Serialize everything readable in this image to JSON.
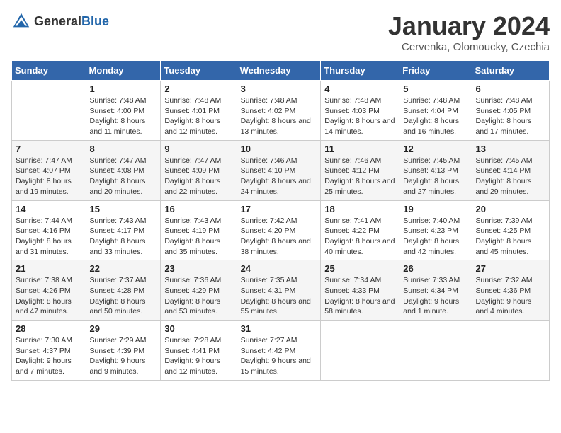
{
  "logo": {
    "general": "General",
    "blue": "Blue"
  },
  "header": {
    "month": "January 2024",
    "location": "Cervenka, Olomoucky, Czechia"
  },
  "weekdays": [
    "Sunday",
    "Monday",
    "Tuesday",
    "Wednesday",
    "Thursday",
    "Friday",
    "Saturday"
  ],
  "weeks": [
    [
      {
        "day": "",
        "sunrise": "",
        "sunset": "",
        "daylight": ""
      },
      {
        "day": "1",
        "sunrise": "Sunrise: 7:48 AM",
        "sunset": "Sunset: 4:00 PM",
        "daylight": "Daylight: 8 hours and 11 minutes."
      },
      {
        "day": "2",
        "sunrise": "Sunrise: 7:48 AM",
        "sunset": "Sunset: 4:01 PM",
        "daylight": "Daylight: 8 hours and 12 minutes."
      },
      {
        "day": "3",
        "sunrise": "Sunrise: 7:48 AM",
        "sunset": "Sunset: 4:02 PM",
        "daylight": "Daylight: 8 hours and 13 minutes."
      },
      {
        "day": "4",
        "sunrise": "Sunrise: 7:48 AM",
        "sunset": "Sunset: 4:03 PM",
        "daylight": "Daylight: 8 hours and 14 minutes."
      },
      {
        "day": "5",
        "sunrise": "Sunrise: 7:48 AM",
        "sunset": "Sunset: 4:04 PM",
        "daylight": "Daylight: 8 hours and 16 minutes."
      },
      {
        "day": "6",
        "sunrise": "Sunrise: 7:48 AM",
        "sunset": "Sunset: 4:05 PM",
        "daylight": "Daylight: 8 hours and 17 minutes."
      }
    ],
    [
      {
        "day": "7",
        "sunrise": "Sunrise: 7:47 AM",
        "sunset": "Sunset: 4:07 PM",
        "daylight": "Daylight: 8 hours and 19 minutes."
      },
      {
        "day": "8",
        "sunrise": "Sunrise: 7:47 AM",
        "sunset": "Sunset: 4:08 PM",
        "daylight": "Daylight: 8 hours and 20 minutes."
      },
      {
        "day": "9",
        "sunrise": "Sunrise: 7:47 AM",
        "sunset": "Sunset: 4:09 PM",
        "daylight": "Daylight: 8 hours and 22 minutes."
      },
      {
        "day": "10",
        "sunrise": "Sunrise: 7:46 AM",
        "sunset": "Sunset: 4:10 PM",
        "daylight": "Daylight: 8 hours and 24 minutes."
      },
      {
        "day": "11",
        "sunrise": "Sunrise: 7:46 AM",
        "sunset": "Sunset: 4:12 PM",
        "daylight": "Daylight: 8 hours and 25 minutes."
      },
      {
        "day": "12",
        "sunrise": "Sunrise: 7:45 AM",
        "sunset": "Sunset: 4:13 PM",
        "daylight": "Daylight: 8 hours and 27 minutes."
      },
      {
        "day": "13",
        "sunrise": "Sunrise: 7:45 AM",
        "sunset": "Sunset: 4:14 PM",
        "daylight": "Daylight: 8 hours and 29 minutes."
      }
    ],
    [
      {
        "day": "14",
        "sunrise": "Sunrise: 7:44 AM",
        "sunset": "Sunset: 4:16 PM",
        "daylight": "Daylight: 8 hours and 31 minutes."
      },
      {
        "day": "15",
        "sunrise": "Sunrise: 7:43 AM",
        "sunset": "Sunset: 4:17 PM",
        "daylight": "Daylight: 8 hours and 33 minutes."
      },
      {
        "day": "16",
        "sunrise": "Sunrise: 7:43 AM",
        "sunset": "Sunset: 4:19 PM",
        "daylight": "Daylight: 8 hours and 35 minutes."
      },
      {
        "day": "17",
        "sunrise": "Sunrise: 7:42 AM",
        "sunset": "Sunset: 4:20 PM",
        "daylight": "Daylight: 8 hours and 38 minutes."
      },
      {
        "day": "18",
        "sunrise": "Sunrise: 7:41 AM",
        "sunset": "Sunset: 4:22 PM",
        "daylight": "Daylight: 8 hours and 40 minutes."
      },
      {
        "day": "19",
        "sunrise": "Sunrise: 7:40 AM",
        "sunset": "Sunset: 4:23 PM",
        "daylight": "Daylight: 8 hours and 42 minutes."
      },
      {
        "day": "20",
        "sunrise": "Sunrise: 7:39 AM",
        "sunset": "Sunset: 4:25 PM",
        "daylight": "Daylight: 8 hours and 45 minutes."
      }
    ],
    [
      {
        "day": "21",
        "sunrise": "Sunrise: 7:38 AM",
        "sunset": "Sunset: 4:26 PM",
        "daylight": "Daylight: 8 hours and 47 minutes."
      },
      {
        "day": "22",
        "sunrise": "Sunrise: 7:37 AM",
        "sunset": "Sunset: 4:28 PM",
        "daylight": "Daylight: 8 hours and 50 minutes."
      },
      {
        "day": "23",
        "sunrise": "Sunrise: 7:36 AM",
        "sunset": "Sunset: 4:29 PM",
        "daylight": "Daylight: 8 hours and 53 minutes."
      },
      {
        "day": "24",
        "sunrise": "Sunrise: 7:35 AM",
        "sunset": "Sunset: 4:31 PM",
        "daylight": "Daylight: 8 hours and 55 minutes."
      },
      {
        "day": "25",
        "sunrise": "Sunrise: 7:34 AM",
        "sunset": "Sunset: 4:33 PM",
        "daylight": "Daylight: 8 hours and 58 minutes."
      },
      {
        "day": "26",
        "sunrise": "Sunrise: 7:33 AM",
        "sunset": "Sunset: 4:34 PM",
        "daylight": "Daylight: 9 hours and 1 minute."
      },
      {
        "day": "27",
        "sunrise": "Sunrise: 7:32 AM",
        "sunset": "Sunset: 4:36 PM",
        "daylight": "Daylight: 9 hours and 4 minutes."
      }
    ],
    [
      {
        "day": "28",
        "sunrise": "Sunrise: 7:30 AM",
        "sunset": "Sunset: 4:37 PM",
        "daylight": "Daylight: 9 hours and 7 minutes."
      },
      {
        "day": "29",
        "sunrise": "Sunrise: 7:29 AM",
        "sunset": "Sunset: 4:39 PM",
        "daylight": "Daylight: 9 hours and 9 minutes."
      },
      {
        "day": "30",
        "sunrise": "Sunrise: 7:28 AM",
        "sunset": "Sunset: 4:41 PM",
        "daylight": "Daylight: 9 hours and 12 minutes."
      },
      {
        "day": "31",
        "sunrise": "Sunrise: 7:27 AM",
        "sunset": "Sunset: 4:42 PM",
        "daylight": "Daylight: 9 hours and 15 minutes."
      },
      {
        "day": "",
        "sunrise": "",
        "sunset": "",
        "daylight": ""
      },
      {
        "day": "",
        "sunrise": "",
        "sunset": "",
        "daylight": ""
      },
      {
        "day": "",
        "sunrise": "",
        "sunset": "",
        "daylight": ""
      }
    ]
  ]
}
